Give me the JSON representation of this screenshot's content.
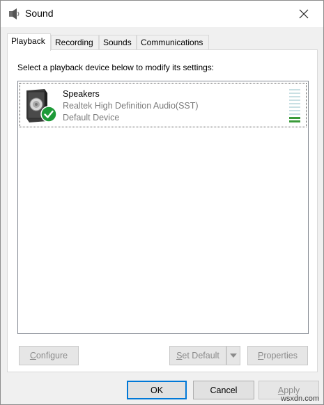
{
  "window": {
    "title": "Sound",
    "icon": "speaker-app-icon",
    "close_icon": "close-icon"
  },
  "tabs": [
    {
      "label": "Playback",
      "active": true
    },
    {
      "label": "Recording",
      "active": false
    },
    {
      "label": "Sounds",
      "active": false
    },
    {
      "label": "Communications",
      "active": false
    }
  ],
  "playback": {
    "instruction": "Select a playback device below to modify its settings:",
    "devices": [
      {
        "name": "Speakers",
        "description": "Realtek High Definition Audio(SST)",
        "status": "Default Device",
        "icon": "speaker-device-icon",
        "badge": "default-check-icon",
        "level_segments_total": 10,
        "level_segments_active": 2
      }
    ],
    "buttons": {
      "configure": {
        "mnemonic": "C",
        "rest": "onfigure"
      },
      "set_default": {
        "mnemonic": "S",
        "rest": "et Default"
      },
      "properties": {
        "mnemonic": "P",
        "rest": "roperties"
      }
    }
  },
  "footer": {
    "ok": "OK",
    "cancel": "Cancel",
    "apply_mnemonic": "A",
    "apply_rest": "pply"
  },
  "watermark": "wsxdn.com",
  "colors": {
    "accent": "#0078d7",
    "check_green": "#1e9a38",
    "meter_active": "#3a9b3a",
    "meter_inactive": "#c9e0e4"
  }
}
